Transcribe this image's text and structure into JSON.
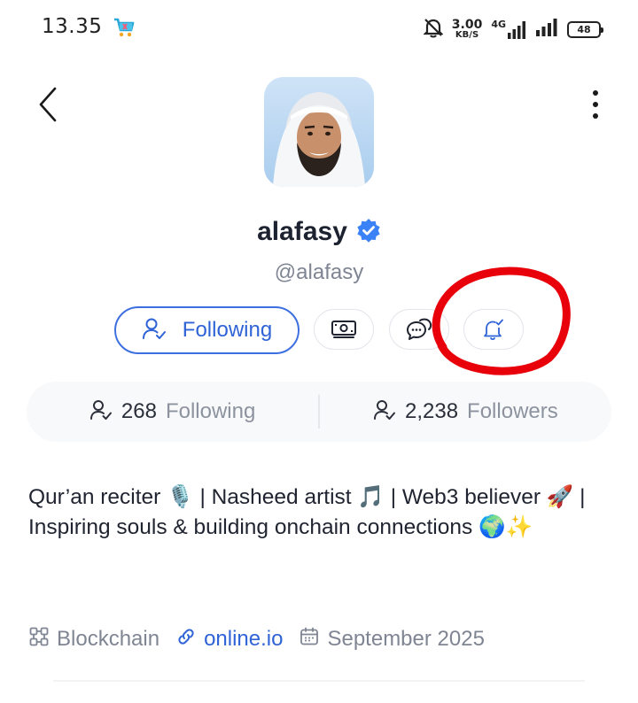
{
  "status_bar": {
    "time": "13.35",
    "net_speed_value": "3.00",
    "net_speed_unit": "KB/S",
    "network_type": "4G",
    "battery": "48"
  },
  "profile": {
    "display_name": "alafasy",
    "handle": "@alafasy",
    "verified": true
  },
  "actions": {
    "following_label": "Following"
  },
  "stats": {
    "following_count": "268",
    "following_label": "Following",
    "followers_count": "2,238",
    "followers_label": "Followers"
  },
  "bio": {
    "text": "Qur’an reciter 🎙️ | Nasheed artist 🎵 | Web3 believer 🚀 | Inspiring souls & building onchain connections 🌍✨"
  },
  "meta": {
    "category": "Blockchain",
    "website": "online.io",
    "joined": "September 2025"
  },
  "colors": {
    "accent": "#2f63d6",
    "verified_badge": "#3b82f6",
    "annotation": "#e8000b"
  }
}
